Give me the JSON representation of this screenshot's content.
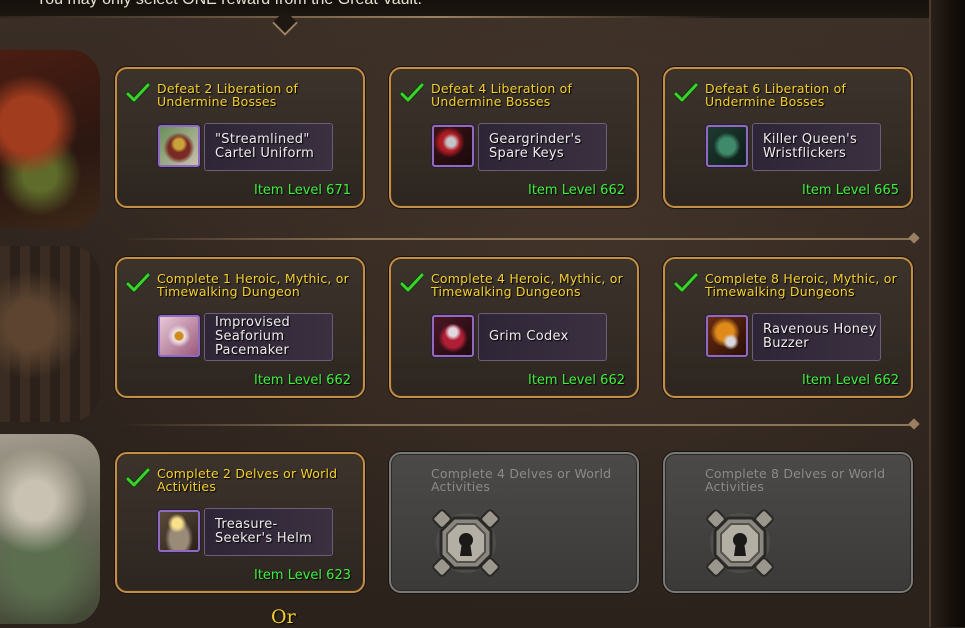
{
  "header": {
    "text": "You may only select ONE reward from the Great Vault."
  },
  "rows": [
    {
      "name": "raid",
      "cards": [
        {
          "title": "Defeat 2 Liberation of Undermine Bosses",
          "completed": true,
          "item": "\"Streamlined\" Cartel Uniform",
          "item_level": "Item Level 671",
          "icon": "cartel-uniform-icon"
        },
        {
          "title": "Defeat 4 Liberation of Undermine Bosses",
          "completed": true,
          "item": "Geargrinder's Spare Keys",
          "item_level": "Item Level 662",
          "icon": "spare-keys-icon"
        },
        {
          "title": "Defeat 6 Liberation of Undermine Bosses",
          "completed": true,
          "item": "Killer Queen's Wristflickers",
          "item_level": "Item Level 665",
          "icon": "wristflickers-icon"
        }
      ]
    },
    {
      "name": "dungeons",
      "cards": [
        {
          "title": "Complete 1 Heroic, Mythic, or Timewalking Dungeon",
          "completed": true,
          "item": "Improvised Seaforium Pacemaker",
          "item_level": "Item Level 662",
          "icon": "pacemaker-icon"
        },
        {
          "title": "Complete 4 Heroic, Mythic, or Timewalking Dungeons",
          "completed": true,
          "item": "Grim Codex",
          "item_level": "Item Level 662",
          "icon": "grim-codex-icon"
        },
        {
          "title": "Complete 8 Heroic, Mythic, or Timewalking Dungeons",
          "completed": true,
          "item": "Ravenous Honey Buzzer",
          "item_level": "Item Level 662",
          "icon": "honey-buzzer-icon"
        }
      ]
    },
    {
      "name": "world",
      "cards": [
        {
          "title": "Complete 2 Delves or World Activities",
          "completed": true,
          "item": "Treasure-Seeker's Helm",
          "item_level": "Item Level 623",
          "icon": "treasure-helm-icon"
        },
        {
          "title": "Complete 4 Delves or World Activities",
          "completed": false,
          "icon": "lock-icon"
        },
        {
          "title": "Complete 8 Delves or World Activities",
          "completed": false,
          "icon": "lock-icon"
        }
      ]
    }
  ],
  "footer": {
    "or_text": "Or"
  },
  "colors": {
    "title_gold": "#f4cf2f",
    "item_level_green": "#3ef03e",
    "card_border_gold": "#c28f4a",
    "locked_border": "#7a7873",
    "epic_purple": "#8f6bbf"
  }
}
